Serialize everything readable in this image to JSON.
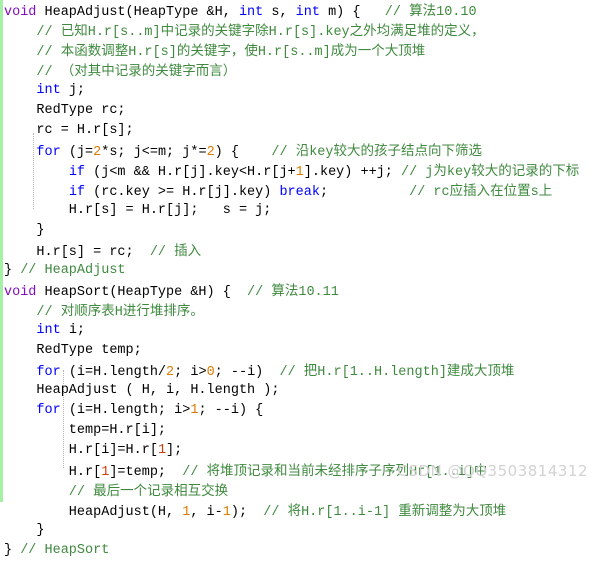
{
  "viewer": {
    "name": "code-snippet-viewer",
    "language": "C",
    "background_color": "#ffffff",
    "gutter_stripe_color": "#a6f0a6"
  },
  "theme": {
    "keyword_color": "#7f0ec0",
    "type_color": "#0000ff",
    "control_color": "#0000ff",
    "number_color": "#e07b00",
    "number_red_color": "#d63b0a",
    "comment_color": "#3f8a3f",
    "plain_color": "#000000",
    "watermark_color": "#d2d2d2"
  },
  "watermark": {
    "text": "CSDN @QQ3503814312"
  },
  "code": {
    "lines": [
      {
        "index": 1,
        "tokens": [
          {
            "t": "void",
            "c": "kw"
          },
          {
            "t": " HeapAdjust(HeapType &H, ",
            "c": "plain"
          },
          {
            "t": "int",
            "c": "type"
          },
          {
            "t": " s, ",
            "c": "plain"
          },
          {
            "t": "int",
            "c": "type"
          },
          {
            "t": " m) {   ",
            "c": "plain"
          },
          {
            "t": "// 算法10.10",
            "c": "comment"
          }
        ]
      },
      {
        "index": 2,
        "tokens": [
          {
            "t": "    // 已知H.r[s..m]中记录的关键字除H.r[s].key之外均满足堆的定义，",
            "c": "comment"
          }
        ]
      },
      {
        "index": 3,
        "tokens": [
          {
            "t": "    // 本函数调整H.r[s]的关键字，使H.r[s..m]成为一个大顶堆",
            "c": "comment"
          }
        ]
      },
      {
        "index": 4,
        "tokens": [
          {
            "t": "    // （对其中记录的关键字而言）",
            "c": "comment"
          }
        ]
      },
      {
        "index": 5,
        "tokens": [
          {
            "t": "    ",
            "c": "plain"
          },
          {
            "t": "int",
            "c": "type"
          },
          {
            "t": " j;",
            "c": "plain"
          }
        ]
      },
      {
        "index": 6,
        "tokens": [
          {
            "t": "    RedType rc;",
            "c": "plain"
          }
        ]
      },
      {
        "index": 7,
        "tokens": [
          {
            "t": "    rc = H.r[s];",
            "c": "plain"
          }
        ]
      },
      {
        "index": 8,
        "tokens": [
          {
            "t": "    ",
            "c": "plain"
          },
          {
            "t": "for",
            "c": "ctrl"
          },
          {
            "t": " (j=",
            "c": "plain"
          },
          {
            "t": "2",
            "c": "num"
          },
          {
            "t": "*s; j<=m; j*=",
            "c": "plain"
          },
          {
            "t": "2",
            "c": "num"
          },
          {
            "t": ") {    ",
            "c": "plain"
          },
          {
            "t": "// 沿key较大的孩子结点向下筛选",
            "c": "comment"
          }
        ]
      },
      {
        "index": 9,
        "tokens": [
          {
            "t": "        ",
            "c": "plain"
          },
          {
            "t": "if",
            "c": "ctrl"
          },
          {
            "t": " (j<m && H.r[j].key<H.r[j+",
            "c": "plain"
          },
          {
            "t": "1",
            "c": "num"
          },
          {
            "t": "].key) ++j; ",
            "c": "plain"
          },
          {
            "t": "// j为key较大的记录的下标",
            "c": "comment"
          }
        ]
      },
      {
        "index": 10,
        "tokens": [
          {
            "t": "        ",
            "c": "plain"
          },
          {
            "t": "if",
            "c": "ctrl"
          },
          {
            "t": " (rc.key >= H.r[j].key) ",
            "c": "plain"
          },
          {
            "t": "break",
            "c": "ctrl"
          },
          {
            "t": ";          ",
            "c": "plain"
          },
          {
            "t": "// rc应插入在位置s上",
            "c": "comment"
          }
        ]
      },
      {
        "index": 11,
        "tokens": [
          {
            "t": "        H.r[s] = H.r[j];   s = j;",
            "c": "plain"
          }
        ]
      },
      {
        "index": 12,
        "tokens": [
          {
            "t": "    }",
            "c": "plain"
          }
        ]
      },
      {
        "index": 13,
        "tokens": [
          {
            "t": "    H.r[s] = rc;  ",
            "c": "plain"
          },
          {
            "t": "// 插入",
            "c": "comment"
          }
        ]
      },
      {
        "index": 14,
        "tokens": [
          {
            "t": "} ",
            "c": "plain"
          },
          {
            "t": "// HeapAdjust",
            "c": "comment"
          }
        ]
      },
      {
        "index": 15,
        "tokens": [
          {
            "t": "void",
            "c": "kw"
          },
          {
            "t": " HeapSort(HeapType &H) {  ",
            "c": "plain"
          },
          {
            "t": "// 算法10.11",
            "c": "comment"
          }
        ]
      },
      {
        "index": 16,
        "tokens": [
          {
            "t": "    // 对顺序表H进行堆排序。",
            "c": "comment"
          }
        ]
      },
      {
        "index": 17,
        "tokens": [
          {
            "t": "    ",
            "c": "plain"
          },
          {
            "t": "int",
            "c": "type"
          },
          {
            "t": " i;",
            "c": "plain"
          }
        ]
      },
      {
        "index": 18,
        "tokens": [
          {
            "t": "    RedType temp;",
            "c": "plain"
          }
        ]
      },
      {
        "index": 19,
        "tokens": [
          {
            "t": "    ",
            "c": "plain"
          },
          {
            "t": "for",
            "c": "ctrl"
          },
          {
            "t": " (i=H.length/",
            "c": "plain"
          },
          {
            "t": "2",
            "c": "num"
          },
          {
            "t": "; i>",
            "c": "plain"
          },
          {
            "t": "0",
            "c": "num"
          },
          {
            "t": "; --i)  ",
            "c": "plain"
          },
          {
            "t": "// 把H.r[1..H.length]建成大顶堆",
            "c": "comment"
          }
        ]
      },
      {
        "index": 20,
        "tokens": [
          {
            "t": "    HeapAdjust ( H, i, H.length );",
            "c": "plain"
          }
        ]
      },
      {
        "index": 21,
        "tokens": [
          {
            "t": "    ",
            "c": "plain"
          },
          {
            "t": "for",
            "c": "ctrl"
          },
          {
            "t": " (i=H.length; i>",
            "c": "plain"
          },
          {
            "t": "1",
            "c": "num"
          },
          {
            "t": "; --i) {",
            "c": "plain"
          }
        ]
      },
      {
        "index": 22,
        "tokens": [
          {
            "t": "        temp=H.r[i];",
            "c": "plain"
          }
        ]
      },
      {
        "index": 23,
        "tokens": [
          {
            "t": "        H.r[i]=H.r[",
            "c": "plain"
          },
          {
            "t": "1",
            "c": "numred"
          },
          {
            "t": "];",
            "c": "plain"
          }
        ]
      },
      {
        "index": 24,
        "tokens": [
          {
            "t": "        H.r[",
            "c": "plain"
          },
          {
            "t": "1",
            "c": "numred"
          },
          {
            "t": "]=temp;  ",
            "c": "plain"
          },
          {
            "t": "// 将堆顶记录和当前未经排序子序列Hr[1..i]中",
            "c": "comment"
          }
        ]
      },
      {
        "index": 25,
        "tokens": [
          {
            "t": "        // 最后一个记录相互交换",
            "c": "comment"
          }
        ]
      },
      {
        "index": 26,
        "tokens": [
          {
            "t": "        HeapAdjust(H, ",
            "c": "plain"
          },
          {
            "t": "1",
            "c": "num"
          },
          {
            "t": ", i-",
            "c": "plain"
          },
          {
            "t": "1",
            "c": "num"
          },
          {
            "t": ");  ",
            "c": "plain"
          },
          {
            "t": "// 将H.r[1..i-1] 重新调整为大顶堆",
            "c": "comment"
          }
        ]
      },
      {
        "index": 27,
        "tokens": [
          {
            "t": "    }",
            "c": "plain"
          }
        ]
      },
      {
        "index": 28,
        "tokens": [
          {
            "t": "} ",
            "c": "plain"
          },
          {
            "t": "// HeapSort",
            "c": "comment"
          }
        ]
      }
    ]
  }
}
